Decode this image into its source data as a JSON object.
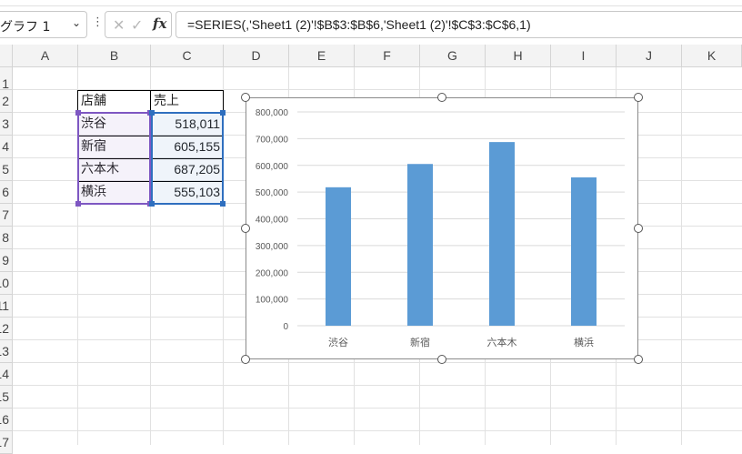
{
  "formula_bar": {
    "name_box": "グラフ 1",
    "formula": "=SERIES(,'Sheet1 (2)'!$B$3:$B$6,'Sheet1 (2)'!$C$3:$C$6,1)",
    "cancel_icon": "close-icon",
    "enter_icon": "check-icon",
    "fx_label": "fx"
  },
  "columns": [
    "A",
    "B",
    "C",
    "D",
    "E",
    "F",
    "G",
    "H",
    "I",
    "J",
    "K"
  ],
  "rows": [
    "1",
    "2",
    "3",
    "4",
    "5",
    "6",
    "7",
    "8",
    "9",
    "10",
    "11",
    "12",
    "13",
    "14",
    "15",
    "16",
    "17"
  ],
  "table": {
    "headers": [
      "店舗",
      "売上"
    ],
    "rows": [
      {
        "store": "渋谷",
        "sales": "518,011"
      },
      {
        "store": "新宿",
        "sales": "605,155"
      },
      {
        "store": "六本木",
        "sales": "687,205"
      },
      {
        "store": "横浜",
        "sales": "555,103"
      }
    ]
  },
  "colors": {
    "bar": "#5b9bd5",
    "category_range": "#7e57c2",
    "value_range": "#2f6fbf",
    "grid": "#d9d9d9",
    "axis_text": "#595959"
  },
  "chart_data": {
    "type": "bar",
    "categories": [
      "渋谷",
      "新宿",
      "六本木",
      "横浜"
    ],
    "values": [
      518011,
      605155,
      687205,
      555103
    ],
    "ylim": [
      0,
      800000
    ],
    "yticks": [
      "0",
      "100,000",
      "200,000",
      "300,000",
      "400,000",
      "500,000",
      "600,000",
      "700,000",
      "800,000"
    ],
    "grid": true,
    "legend": "none"
  }
}
